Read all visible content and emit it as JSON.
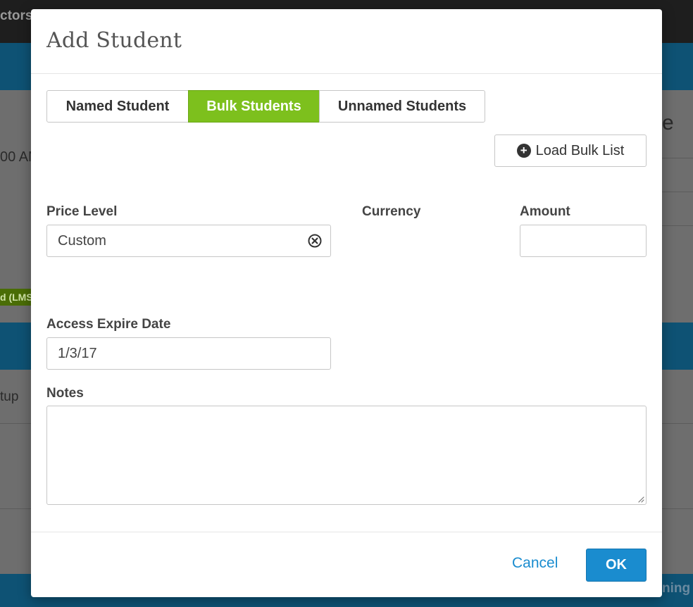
{
  "background": {
    "topbar_text": "ctors",
    "time_text": "00 AM",
    "right_letter": "e",
    "badge_text": "d (LMS)",
    "setup_text": "tup",
    "bottom_right_text": "ning"
  },
  "modal": {
    "title": "Add Student",
    "tabs": [
      {
        "label": "Named Student",
        "active": false
      },
      {
        "label": "Bulk Students",
        "active": true
      },
      {
        "label": "Unnamed Students",
        "active": false
      }
    ],
    "load_bulk_list_label": "Load Bulk List",
    "price_level": {
      "label": "Price Level",
      "value": "Custom"
    },
    "currency": {
      "label": "Currency"
    },
    "amount": {
      "label": "Amount",
      "value": ""
    },
    "access_expire_date": {
      "label": "Access Expire Date",
      "value": "1/3/17"
    },
    "notes": {
      "label": "Notes",
      "value": ""
    },
    "footer": {
      "cancel_label": "Cancel",
      "ok_label": "OK"
    }
  },
  "colors": {
    "active_tab": "#7dc01d",
    "primary_button": "#1a8ccf",
    "link": "#1a8ccf",
    "page_band": "#0e5274"
  },
  "icons": {
    "load_bulk_list": "plus-circle-icon",
    "price_level_clear": "clear-circle-icon",
    "notes_resize": "resize-grip-icon"
  }
}
